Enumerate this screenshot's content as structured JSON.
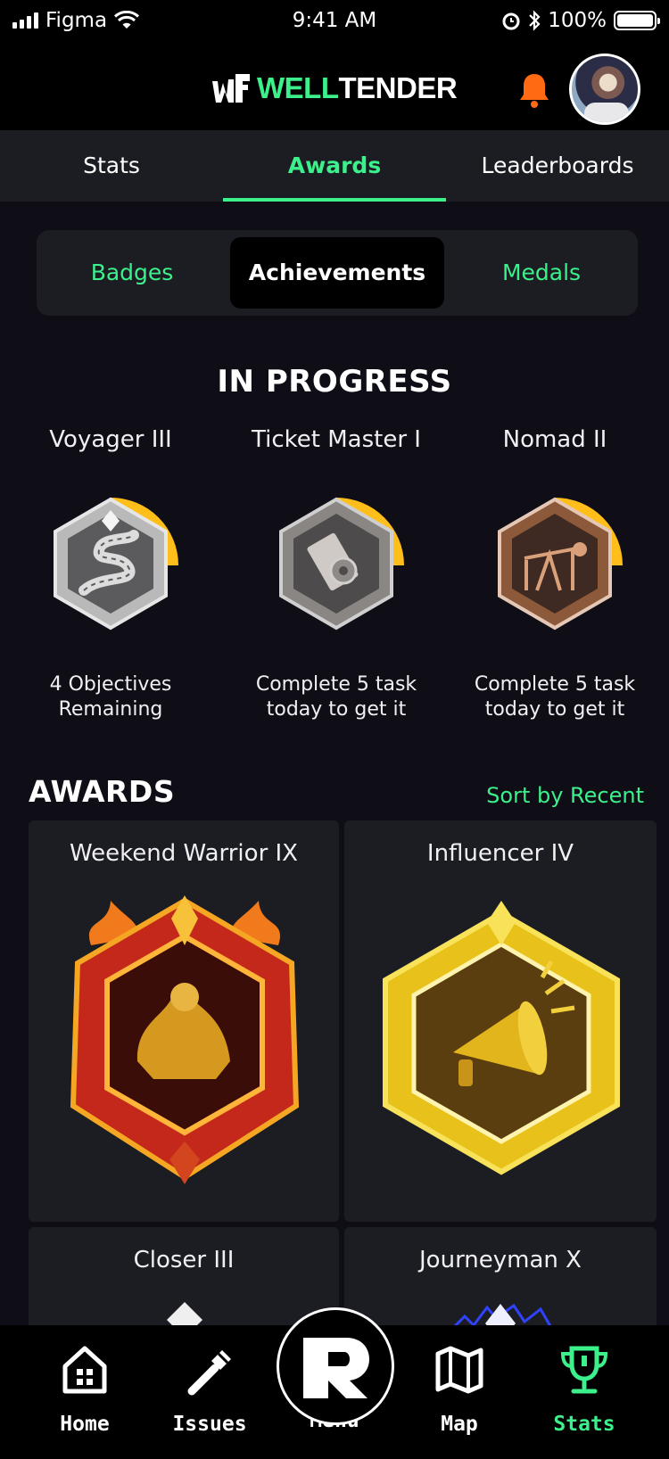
{
  "status_bar": {
    "carrier": "Figma",
    "time": "9:41 AM",
    "battery": "100%"
  },
  "header": {
    "logo_part1": "WELL",
    "logo_part2": "TENDER"
  },
  "tabs": [
    {
      "label": "Stats",
      "active": false
    },
    {
      "label": "Awards",
      "active": true
    },
    {
      "label": "Leaderboards",
      "active": false
    }
  ],
  "segments": [
    {
      "label": "Badges",
      "active": false
    },
    {
      "label": "Achievements",
      "active": true
    },
    {
      "label": "Medals",
      "active": false
    }
  ],
  "in_progress": {
    "title": "IN PROGRESS",
    "items": [
      {
        "name": "Voyager III",
        "desc_line1": "4 Objectives",
        "desc_line2": "Remaining",
        "icon": "road-icon",
        "progress": 0.25
      },
      {
        "name": "Ticket Master I",
        "desc_line1": "Complete 5 task",
        "desc_line2": "today to get it",
        "icon": "ticket-icon",
        "progress": 0.25
      },
      {
        "name": "Nomad II",
        "desc_line1": "Complete 5 task",
        "desc_line2": "today to get it",
        "icon": "pump-jack-icon",
        "progress": 0.25
      }
    ]
  },
  "awards": {
    "title": "AWARDS",
    "sort_label": "Sort by Recent",
    "items": [
      {
        "name": "Weekend Warrior IX",
        "icon": "arm-wrestle-icon"
      },
      {
        "name": "Influencer IV",
        "icon": "megaphone-icon"
      },
      {
        "name": "Closer III",
        "icon": "closer-badge-icon"
      },
      {
        "name": "Journeyman X",
        "icon": "journeyman-badge-icon"
      }
    ]
  },
  "nav": [
    {
      "label": "Home",
      "icon": "home-icon",
      "active": false
    },
    {
      "label": "Issues",
      "icon": "wrench-icon",
      "active": false
    },
    {
      "label": "Menu",
      "icon": "menu-logo-icon",
      "active": false
    },
    {
      "label": "Map",
      "icon": "map-icon",
      "active": false
    },
    {
      "label": "Stats",
      "icon": "trophy-icon",
      "active": true
    }
  ],
  "colors": {
    "accent": "#3cf08b",
    "background": "#0f0e17",
    "panel": "#1c1d22",
    "progress": "#ffbe1a",
    "bell": "#ff6a13"
  }
}
